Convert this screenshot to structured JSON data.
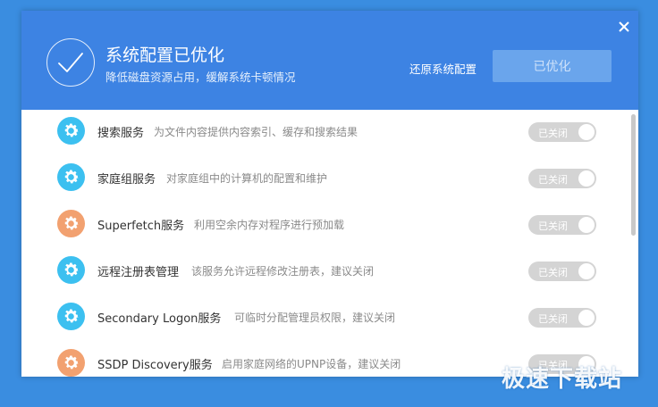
{
  "header": {
    "title": "系统配置已优化",
    "subtitle": "降低磁盘资源占用，缓解系统卡顿情况",
    "restore_label": "还原系统配置",
    "optimized_label": "已优化",
    "close_icon": "close-icon",
    "status_icon": "checkmark-circle-icon"
  },
  "colors": {
    "header_bg": "#3d83e3",
    "icon_blue": "#3cc0f0",
    "icon_orange": "#f2a170",
    "toggle_off": "#d4d4d4"
  },
  "services": [
    {
      "name": "搜索服务",
      "desc": "为文件内容提供内容索引、缓存和搜索结果",
      "toggle": "已关闭",
      "icon_color": "blue"
    },
    {
      "name": "家庭组服务",
      "desc": "对家庭组中的计算机的配置和维护",
      "toggle": "已关闭",
      "icon_color": "blue"
    },
    {
      "name": "Superfetch服务",
      "desc": "利用空余内存对程序进行预加载",
      "toggle": "已关闭",
      "icon_color": "orange"
    },
    {
      "name": "远程注册表管理",
      "desc": "该服务允许远程修改注册表，建议关闭",
      "toggle": "已关闭",
      "icon_color": "blue"
    },
    {
      "name": "Secondary Logon服务",
      "desc": "可临时分配管理员权限，建议关闭",
      "toggle": "已关闭",
      "icon_color": "blue"
    },
    {
      "name": "SSDP Discovery服务",
      "desc": "启用家庭网络的UPNP设备，建议关闭",
      "toggle": "已关闭",
      "icon_color": "orange"
    }
  ],
  "watermark": "极速下载站"
}
